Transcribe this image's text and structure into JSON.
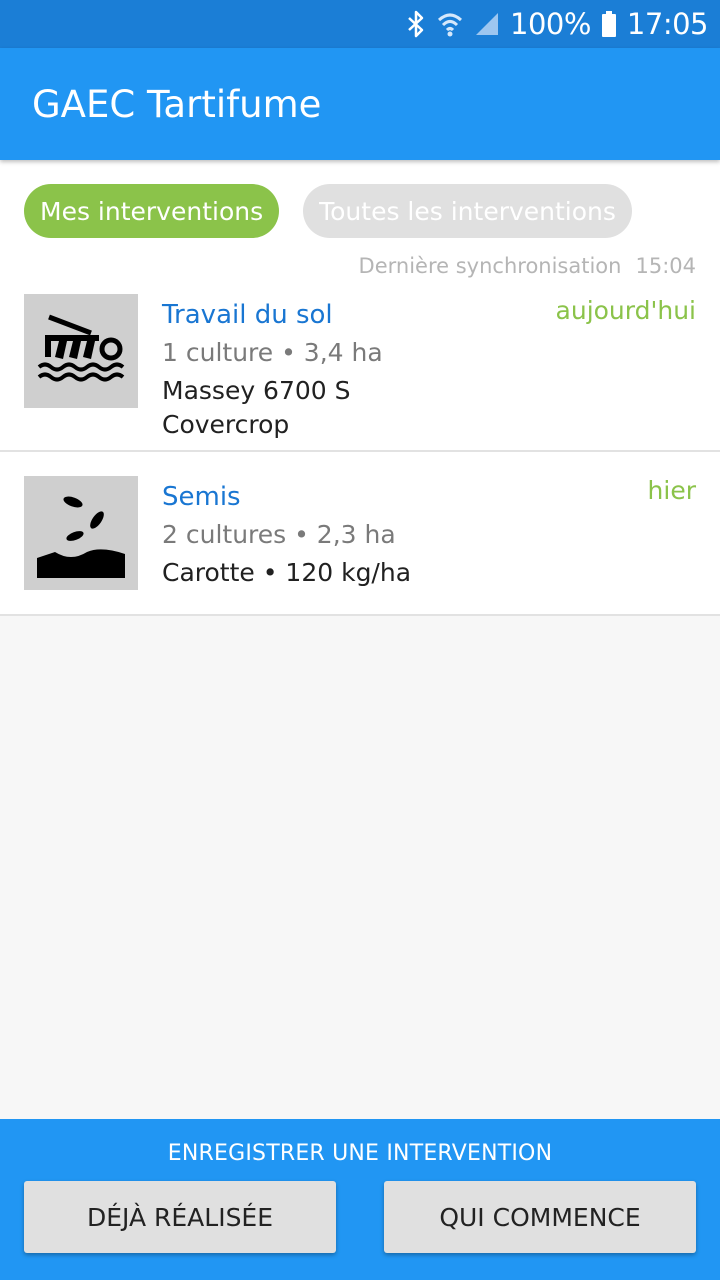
{
  "status_bar": {
    "battery": "100%",
    "time": "17:05",
    "icons": [
      "bluetooth-icon",
      "wifi-icon",
      "signal-icon",
      "battery-icon"
    ]
  },
  "app_bar": {
    "title": "GAEC Tartifume"
  },
  "filters": {
    "active": "Mes interventions",
    "inactive": "Toutes les interventions"
  },
  "sync": {
    "label": "Dernière synchronisation",
    "time": "15:04"
  },
  "interventions": [
    {
      "title": "Travail du sol",
      "meta": "1 culture • 3,4 ha",
      "detail": "Massey 6700 S\nCovercrop",
      "date": "aujourd'hui",
      "icon": "soil-tillage-icon"
    },
    {
      "title": "Semis",
      "meta": "2 cultures • 2,3 ha",
      "detail": "Carotte • 120 kg/ha",
      "date": "hier",
      "icon": "sowing-icon"
    }
  ],
  "bottom_panel": {
    "label": "ENREGISTRER UNE INTERVENTION",
    "button_done": "DÉJÀ RÉALISÉE",
    "button_start": "QUI COMMENCE"
  },
  "colors": {
    "status_bar": "#1b7ed6",
    "primary": "#2196f3",
    "accent_green": "#8bc34a",
    "title_blue": "#1976d2"
  }
}
